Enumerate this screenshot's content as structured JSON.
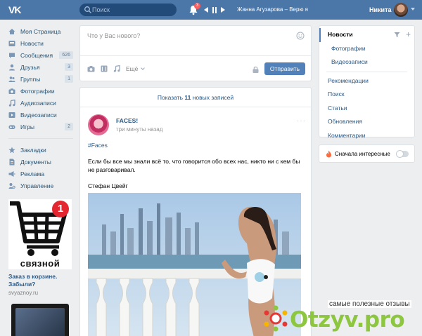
{
  "header": {
    "logo": "VK",
    "search_placeholder": "Поиск",
    "notifications_count": "3",
    "track": "Жанна Агузарова – Верю я",
    "user_name": "Никита"
  },
  "left_menu": {
    "items": [
      {
        "label": "Моя Страница",
        "icon": "home-icon"
      },
      {
        "label": "Новости",
        "icon": "news-icon"
      },
      {
        "label": "Сообщения",
        "icon": "message-icon",
        "count": "626"
      },
      {
        "label": "Друзья",
        "icon": "friends-icon",
        "count": "3"
      },
      {
        "label": "Группы",
        "icon": "groups-icon",
        "count": "1"
      },
      {
        "label": "Фотографии",
        "icon": "camera-icon"
      },
      {
        "label": "Аудиозаписи",
        "icon": "music-icon"
      },
      {
        "label": "Видеозаписи",
        "icon": "video-icon"
      },
      {
        "label": "Игры",
        "icon": "games-icon",
        "count": "2"
      }
    ],
    "items2": [
      {
        "label": "Закладки",
        "icon": "star-icon"
      },
      {
        "label": "Документы",
        "icon": "document-icon"
      },
      {
        "label": "Реклама",
        "icon": "ads-icon"
      },
      {
        "label": "Управление",
        "icon": "manage-icon"
      }
    ]
  },
  "ad": {
    "badge": "1",
    "brand": "связной",
    "title": "Заказ в корзине. Забыли?",
    "domain": "svyaznoy.ru"
  },
  "composer": {
    "placeholder": "Что у Вас нового?",
    "more_label": "Ещё",
    "send_label": "Отправить"
  },
  "feed": {
    "show_new_prefix": "Показать ",
    "show_new_count": "11",
    "show_new_suffix": " новых записей",
    "post": {
      "author": "FACES!",
      "time": "три минуты назад",
      "hashtag": "#Faces",
      "text": "Если бы все мы знали всё то, что говорится обо всех нас, никто ни с кем бы не разговаривал.",
      "signature": "Стефан Цвейг"
    }
  },
  "right_menu": {
    "items": [
      {
        "label": "Новости",
        "active": true
      },
      {
        "label": "Фотографии",
        "sub": true
      },
      {
        "label": "Видеозаписи",
        "sub": true
      },
      {
        "label": "Рекомендации"
      },
      {
        "label": "Поиск"
      },
      {
        "label": "Статьи"
      },
      {
        "label": "Обновления"
      },
      {
        "label": "Комментарии"
      }
    ],
    "interest_label": "Сначала интересные"
  },
  "watermark": {
    "tagline": "самые полезные отзывы",
    "logo": "Otzyv.pro"
  },
  "colors": {
    "header": "#4a76a8",
    "link": "#2a5885",
    "button": "#5181b8",
    "background": "#edeef0",
    "watermark": "#8dc63f"
  }
}
